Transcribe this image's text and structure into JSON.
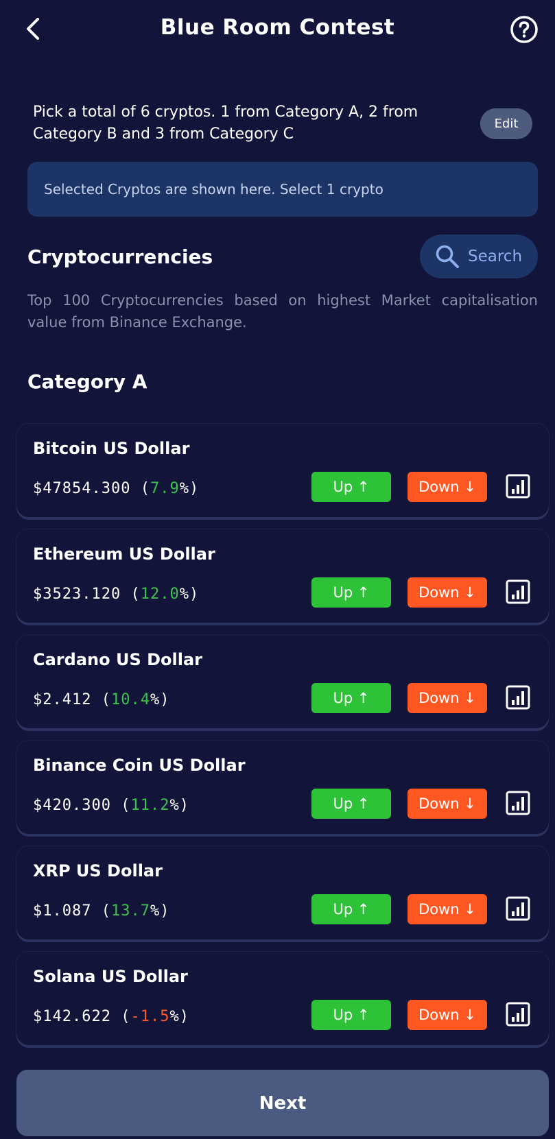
{
  "header": {
    "title": "Blue Room Contest"
  },
  "intro": {
    "text": "Pick a total of 6 cryptos. 1 from Category A, 2 from Category B and 3 from Category C",
    "edit_label": "Edit"
  },
  "selected_box": {
    "text": "Selected Cryptos are shown here. Select 1 crypto"
  },
  "section": {
    "title": "Cryptocurrencies",
    "search_label": "Search",
    "description": "Top 100 Cryptocurrencies based on highest Market capitalisation value from Binance Exchange."
  },
  "category": {
    "title": "Category A"
  },
  "cryptos": [
    {
      "name": "Bitcoin US Dollar",
      "price": "$47854.300",
      "change": "7.9",
      "trend": "pos"
    },
    {
      "name": "Ethereum US Dollar",
      "price": "$3523.120",
      "change": "12.0",
      "trend": "pos"
    },
    {
      "name": "Cardano US Dollar",
      "price": "$2.412",
      "change": "10.4",
      "trend": "pos"
    },
    {
      "name": "Binance Coin US Dollar",
      "price": "$420.300",
      "change": "11.2",
      "trend": "pos"
    },
    {
      "name": "XRP US Dollar",
      "price": "$1.087",
      "change": "13.7",
      "trend": "pos"
    },
    {
      "name": "Solana US Dollar",
      "price": "$142.622",
      "change": "-1.5",
      "trend": "neg"
    }
  ],
  "buttons": {
    "up_label": "Up",
    "down_label": "Down",
    "next_label": "Next"
  },
  "colors": {
    "background": "#121539",
    "up": "#2dc237",
    "down": "#ff5722",
    "positive": "#3cc34e",
    "negative": "#ff5a2a",
    "panel": "#1d3467"
  }
}
